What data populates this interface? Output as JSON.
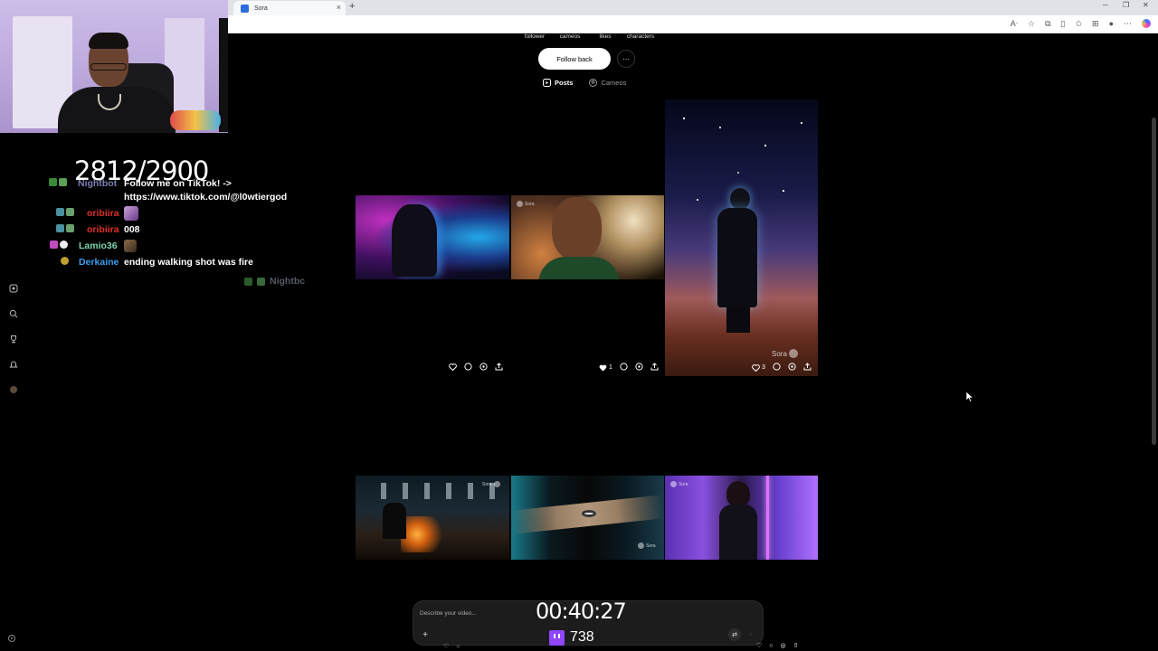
{
  "browser": {
    "tab_title": "Sora",
    "tab_close": "×",
    "new_tab": "+"
  },
  "stream": {
    "sub_goal": "2812/2900",
    "timer": "00:40:27",
    "viewers": "738",
    "chat": [
      {
        "user": "Nightbot",
        "user_color": "#7a7fb3",
        "message": "Follow me on TikTok! ->"
      },
      {
        "user": "",
        "user_color": "#fff",
        "message": "https://www.tiktok.com/@l0wtiergod"
      },
      {
        "user": "oribiira",
        "user_color": "#e0302a",
        "message": ""
      },
      {
        "user": "oribiira",
        "user_color": "#e0302a",
        "message": "008"
      },
      {
        "user": "Lamio36",
        "user_color": "#7fd4b0",
        "message": ""
      },
      {
        "user": "Derkaine",
        "user_color": "#3c9ff0",
        "message": "ending walking shot was fire"
      }
    ],
    "partial_user": "Nightbc"
  },
  "profile": {
    "stats": [
      "follower",
      "cameos",
      "likes",
      "characters"
    ],
    "follow_button": "Follow back",
    "more_button": "···",
    "tabs": [
      {
        "label": "Posts",
        "active": true
      },
      {
        "label": "Cameos",
        "active": false
      }
    ]
  },
  "posts": [
    {
      "likes": ""
    },
    {
      "likes": "1"
    },
    {
      "likes": "3",
      "watermark": "Sora"
    },
    {
      "watermark": "Sora"
    },
    {
      "watermark": "Sora"
    },
    {
      "watermark": "Sora"
    }
  ],
  "composer": {
    "placeholder": "Describe your video...",
    "plus": "+"
  }
}
